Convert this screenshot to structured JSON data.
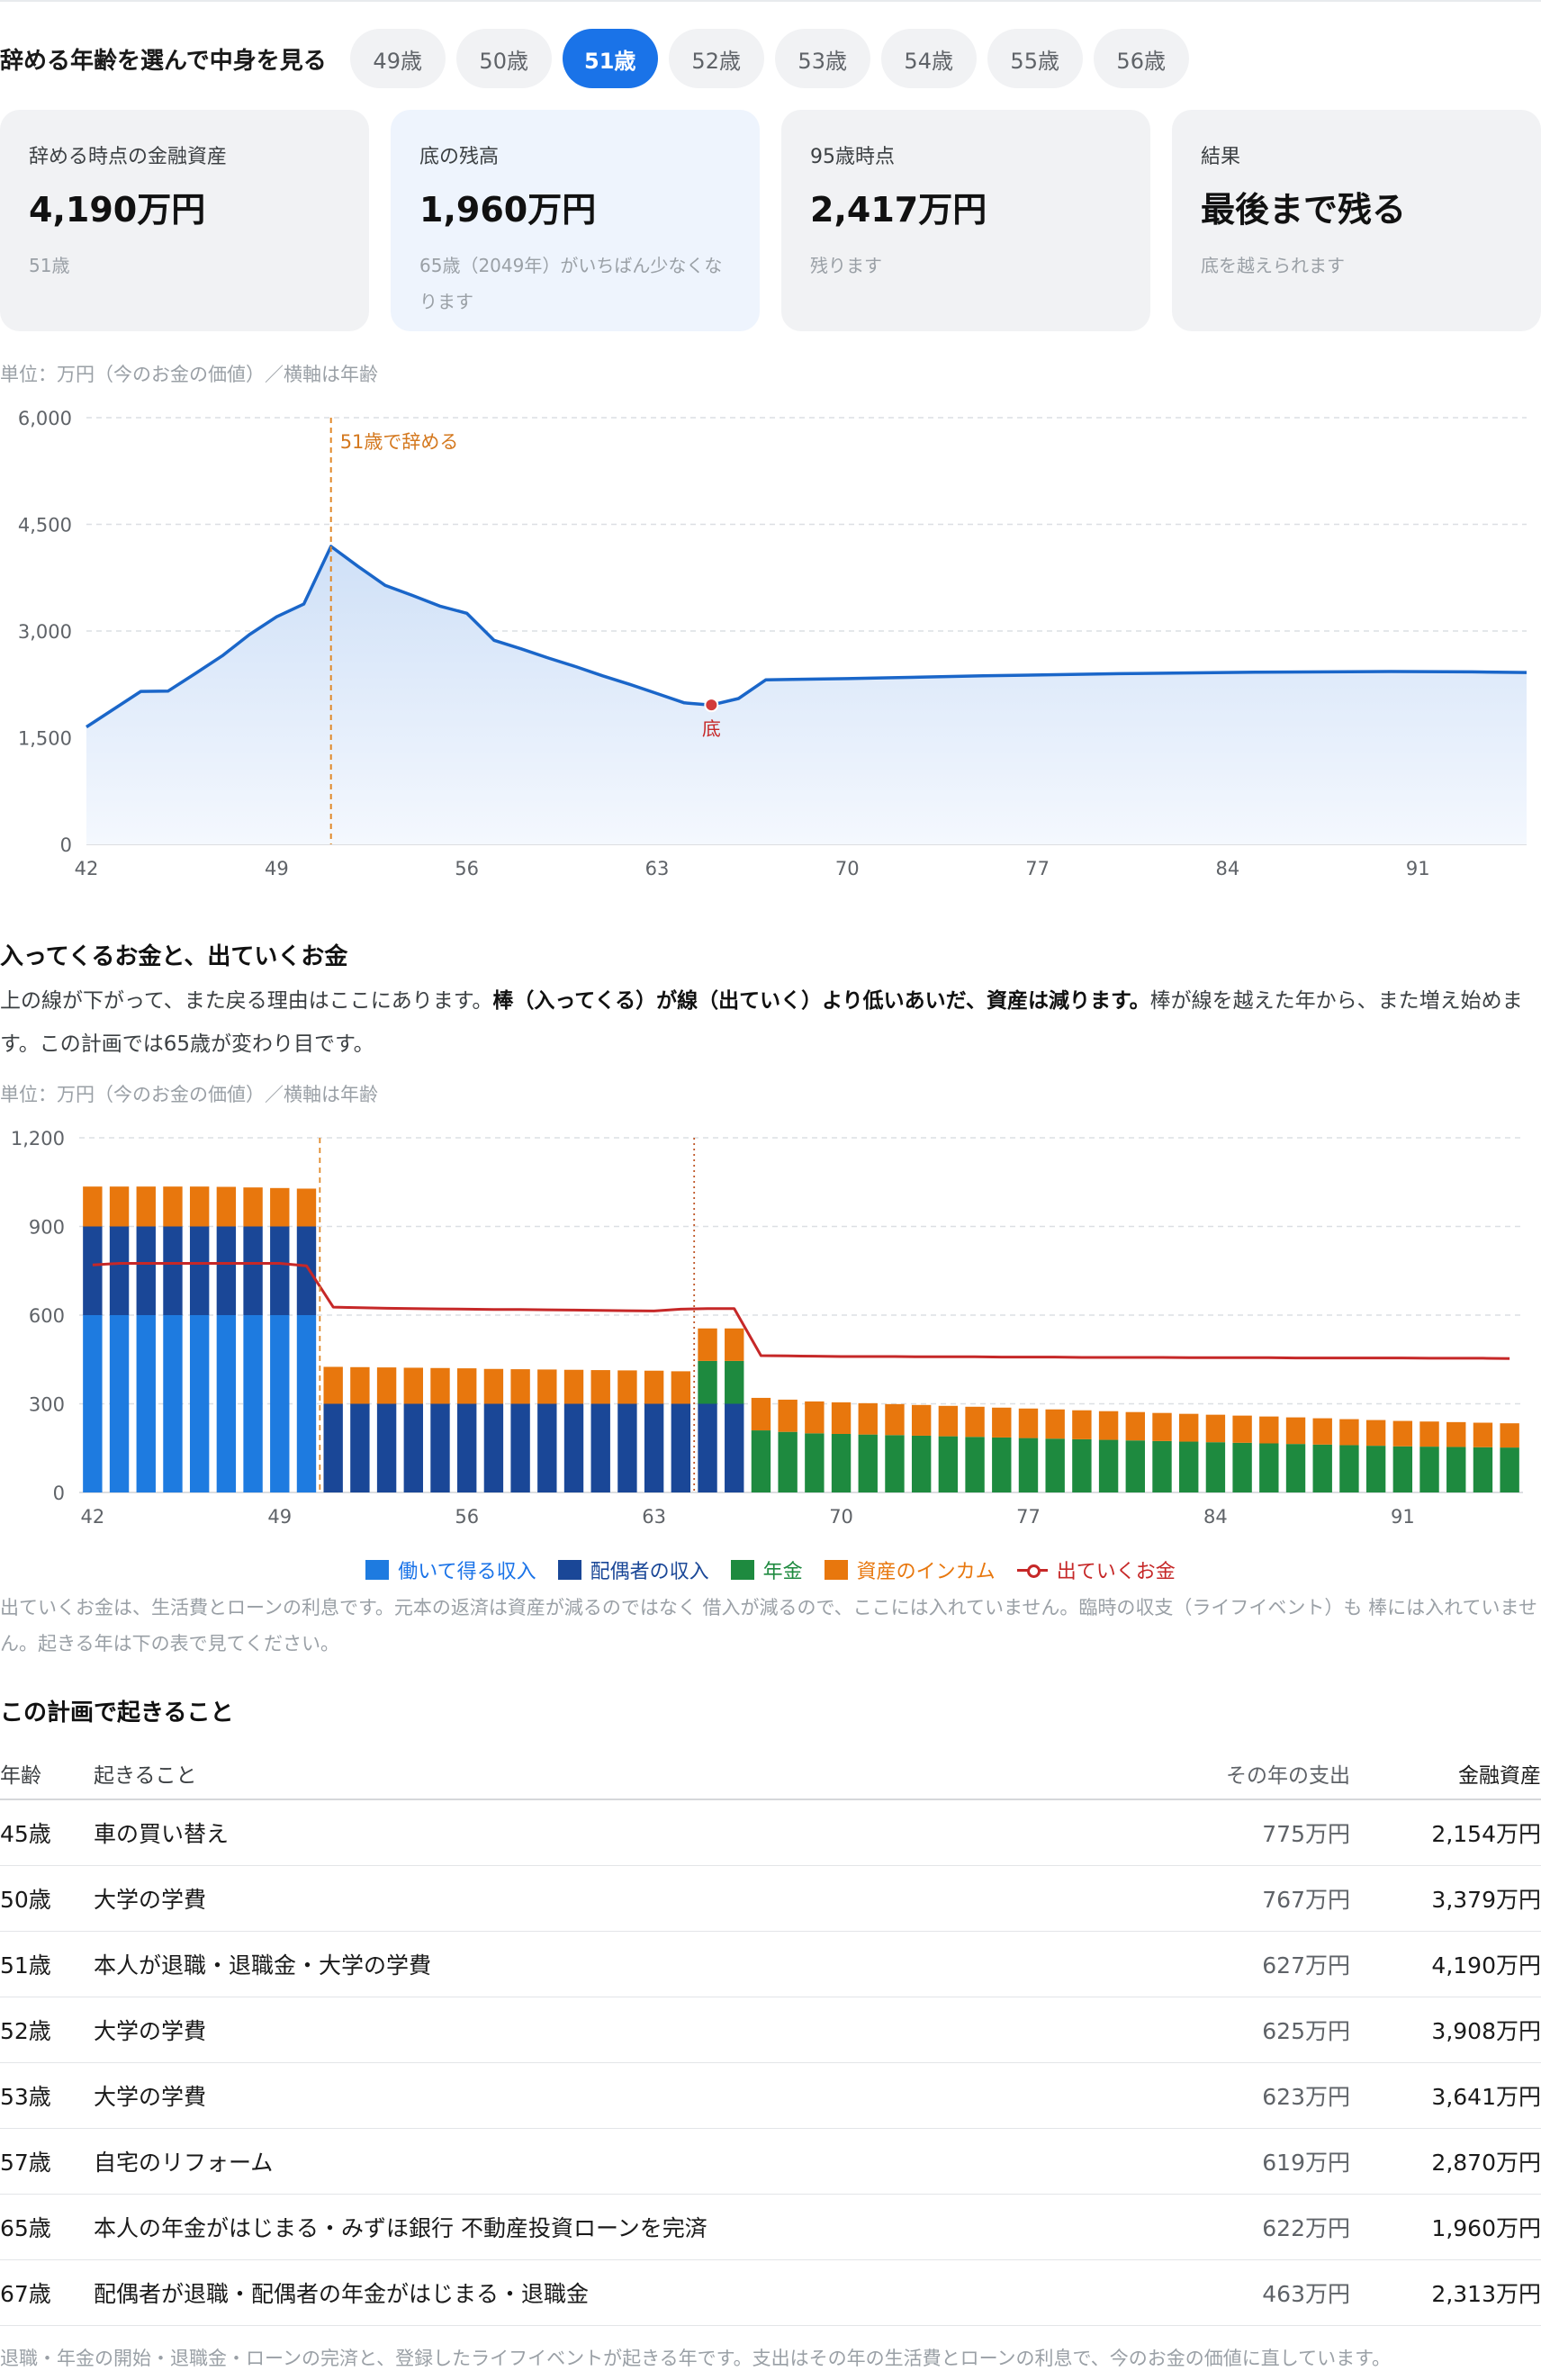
{
  "selector": {
    "label": "辞める年齢を選んで中身を見る",
    "options": [
      "49歳",
      "50歳",
      "51歳",
      "52歳",
      "53歳",
      "54歳",
      "55歳",
      "56歳"
    ],
    "selected_index": 2
  },
  "cards": [
    {
      "label": "辞める時点の金融資産",
      "value": "4,190万円",
      "note": "51歳"
    },
    {
      "label": "底の残高",
      "value": "1,960万円",
      "note": "65歳（2049年）がいちばん少なくなります"
    },
    {
      "label": "95歳時点",
      "value": "2,417万円",
      "note": "残ります"
    },
    {
      "label": "結果",
      "value": "最後まで残る",
      "note": "底を越えられます"
    }
  ],
  "asset_chart": {
    "unit_note": "単位：万円（今のお金の価値）／横軸は年齢",
    "retire_label": "51歳で辞める",
    "bottom_label": "底"
  },
  "flow_section": {
    "title": "入ってくるお金と、出ていくお金",
    "para_1": "上の線が下がって、また戻る理由はここにあります。",
    "para_bold": "棒（入ってくる）が線（出ていく）より低いあいだ、資産は減ります。",
    "para_2": "棒が線を越えた年から、また増え始めます。この計画では65歳が変わり目です。",
    "unit_note": "単位：万円（今のお金の価値）／横軸は年齢",
    "note": "出ていくお金は、生活費とローンの利息です。元本の返済は資産が減るのではなく 借入が減るので、ここには入れていません。臨時の収支（ライフイベント）も 棒には入れていません。起きる年は下の表で見てください。"
  },
  "legend": [
    {
      "label": "働いて得る収入",
      "color": "#1e7be0"
    },
    {
      "label": "配偶者の収入",
      "color": "#1a4797"
    },
    {
      "label": "年金",
      "color": "#1e8a3f"
    },
    {
      "label": "資産のインカム",
      "color": "#e8770d"
    },
    {
      "label": "出ていくお金",
      "color": "#c62828"
    }
  ],
  "chart_data": [
    {
      "type": "area",
      "ylim": [
        0,
        6000
      ],
      "yticks": [
        0,
        1500,
        3000,
        4500,
        6000
      ],
      "xticks": [
        42,
        49,
        56,
        63,
        70,
        77,
        84,
        91
      ],
      "xlim": [
        42,
        95
      ],
      "grid": true,
      "x": [
        42,
        43,
        44,
        45,
        46,
        47,
        48,
        49,
        50,
        51,
        52,
        53,
        54,
        55,
        56,
        57,
        58,
        59,
        60,
        61,
        62,
        63,
        64,
        65,
        66,
        67,
        68,
        70,
        75,
        80,
        85,
        90,
        93,
        95
      ],
      "values": [
        1650,
        1900,
        2150,
        2154,
        2400,
        2650,
        2950,
        3200,
        3379,
        4190,
        3908,
        3641,
        3500,
        3350,
        3250,
        2870,
        2750,
        2620,
        2500,
        2370,
        2250,
        2120,
        1990,
        1960,
        2050,
        2313,
        2320,
        2330,
        2370,
        2400,
        2420,
        2430,
        2425,
        2417
      ],
      "annotations": [
        {
          "x": 51,
          "label": "51歳で辞める"
        },
        {
          "x": 65,
          "label": "底"
        }
      ]
    },
    {
      "type": "bar",
      "stacked": true,
      "ylim": [
        0,
        1200
      ],
      "yticks": [
        0,
        300,
        600,
        900,
        1200
      ],
      "xticks": [
        42,
        49,
        56,
        63,
        70,
        77,
        84,
        91
      ],
      "grid": true,
      "x": [
        42,
        43,
        44,
        45,
        46,
        47,
        48,
        49,
        50,
        51,
        52,
        53,
        54,
        55,
        56,
        57,
        58,
        59,
        60,
        61,
        62,
        63,
        64,
        65,
        66,
        67,
        68,
        69,
        70,
        71,
        72,
        73,
        74,
        75,
        76,
        77,
        78,
        79,
        80,
        81,
        82,
        83,
        84,
        85,
        86,
        87,
        88,
        89,
        90,
        91,
        92,
        93,
        94,
        95
      ],
      "series": [
        {
          "name": "働いて得る収入",
          "values": [
            600,
            600,
            600,
            600,
            600,
            600,
            600,
            600,
            600,
            0,
            0,
            0,
            0,
            0,
            0,
            0,
            0,
            0,
            0,
            0,
            0,
            0,
            0,
            0,
            0,
            0,
            0,
            0,
            0,
            0,
            0,
            0,
            0,
            0,
            0,
            0,
            0,
            0,
            0,
            0,
            0,
            0,
            0,
            0,
            0,
            0,
            0,
            0,
            0,
            0,
            0,
            0,
            0,
            0
          ]
        },
        {
          "name": "配偶者の収入",
          "values": [
            300,
            300,
            300,
            300,
            300,
            300,
            300,
            300,
            300,
            300,
            300,
            300,
            300,
            300,
            300,
            300,
            300,
            300,
            300,
            300,
            300,
            300,
            300,
            300,
            300,
            0,
            0,
            0,
            0,
            0,
            0,
            0,
            0,
            0,
            0,
            0,
            0,
            0,
            0,
            0,
            0,
            0,
            0,
            0,
            0,
            0,
            0,
            0,
            0,
            0,
            0,
            0,
            0,
            0
          ]
        },
        {
          "name": "年金",
          "values": [
            0,
            0,
            0,
            0,
            0,
            0,
            0,
            0,
            0,
            0,
            0,
            0,
            0,
            0,
            0,
            0,
            0,
            0,
            0,
            0,
            0,
            0,
            0,
            145,
            145,
            210,
            205,
            200,
            198,
            196,
            194,
            192,
            190,
            188,
            186,
            184,
            182,
            180,
            178,
            176,
            174,
            172,
            170,
            168,
            166,
            164,
            162,
            160,
            158,
            156,
            155,
            154,
            153,
            152
          ]
        },
        {
          "name": "資産のインカム",
          "values": [
            135,
            135,
            135,
            135,
            135,
            134,
            132,
            130,
            128,
            125,
            124,
            123,
            122,
            121,
            120,
            118,
            117,
            116,
            115,
            114,
            113,
            112,
            110,
            110,
            110,
            110,
            109,
            108,
            107,
            106,
            105,
            104,
            103,
            102,
            101,
            100,
            99,
            98,
            97,
            96,
            95,
            94,
            93,
            92,
            91,
            90,
            89,
            88,
            87,
            86,
            85,
            84,
            83,
            82
          ]
        },
        {
          "name": "出ていくお金",
          "values": [
            770,
            775,
            775,
            775,
            775,
            775,
            775,
            775,
            767,
            627,
            625,
            623,
            622,
            621,
            620,
            619,
            619,
            618,
            617,
            616,
            615,
            614,
            620,
            622,
            622,
            463,
            462,
            461,
            460,
            460,
            460,
            459,
            459,
            459,
            458,
            458,
            458,
            457,
            457,
            457,
            457,
            456,
            456,
            456,
            456,
            455,
            455,
            455,
            455,
            455,
            454,
            454,
            454,
            453
          ]
        }
      ],
      "markers": [
        51,
        65
      ]
    }
  ],
  "events_section": {
    "title": "この計画で起きること",
    "headers": [
      "年齢",
      "起きること",
      "その年の支出",
      "金融資産"
    ],
    "rows": [
      {
        "age": "45歳",
        "event": "車の買い替え",
        "expense": "775万円",
        "asset": "2,154万円"
      },
      {
        "age": "50歳",
        "event": "大学の学費",
        "expense": "767万円",
        "asset": "3,379万円"
      },
      {
        "age": "51歳",
        "event": "本人が退職・退職金・大学の学費",
        "expense": "627万円",
        "asset": "4,190万円"
      },
      {
        "age": "52歳",
        "event": "大学の学費",
        "expense": "625万円",
        "asset": "3,908万円"
      },
      {
        "age": "53歳",
        "event": "大学の学費",
        "expense": "623万円",
        "asset": "3,641万円"
      },
      {
        "age": "57歳",
        "event": "自宅のリフォーム",
        "expense": "619万円",
        "asset": "2,870万円"
      },
      {
        "age": "65歳",
        "event": "本人の年金がはじまる・みずほ銀行 不動産投資ローンを完済",
        "expense": "622万円",
        "asset": "1,960万円"
      },
      {
        "age": "67歳",
        "event": "配偶者が退職・配偶者の年金がはじまる・退職金",
        "expense": "463万円",
        "asset": "2,313万円"
      }
    ],
    "footnote": "退職・年金の開始・退職金・ローンの完済と、登録したライフイベントが起きる年です。支出はその年の生活費とローンの利息で、今のお金の価値に直しています。"
  }
}
